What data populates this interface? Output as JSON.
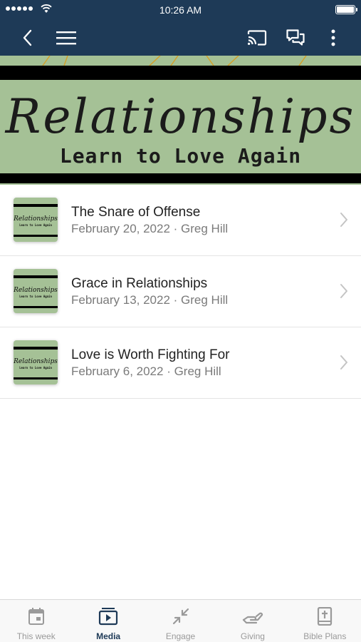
{
  "status_bar": {
    "time": "10:26 AM"
  },
  "nav": {
    "back_icon": "chevron-left-icon",
    "menu_icon": "hamburger-icon",
    "cast_icon": "cast-icon",
    "chat_icon": "chat-icon",
    "more_icon": "more-vertical-icon",
    "color": "#1e3a57"
  },
  "banner": {
    "title": "Relationships",
    "subtitle": "Learn to Love Again",
    "background": "#a5c196"
  },
  "sermons": [
    {
      "title": "The Snare of Offense",
      "meta": "February 20, 2022 · Greg Hill",
      "thumb_title": "Relationships",
      "thumb_subtitle": "Learn to Love Again"
    },
    {
      "title": "Grace in Relationships",
      "meta": "February 13, 2022 · Greg Hill",
      "thumb_title": "Relationships",
      "thumb_subtitle": "Learn to Love Again"
    },
    {
      "title": "Love is Worth Fighting For",
      "meta": "February 6, 2022 · Greg Hill",
      "thumb_title": "Relationships",
      "thumb_subtitle": "Learn to Love Again"
    }
  ],
  "tabs": [
    {
      "label": "This week",
      "icon": "calendar-icon",
      "active": false
    },
    {
      "label": "Media",
      "icon": "media-icon",
      "active": true
    },
    {
      "label": "Engage",
      "icon": "engage-icon",
      "active": false
    },
    {
      "label": "Giving",
      "icon": "giving-icon",
      "active": false
    },
    {
      "label": "Bible Plans",
      "icon": "bible-icon",
      "active": false
    }
  ]
}
